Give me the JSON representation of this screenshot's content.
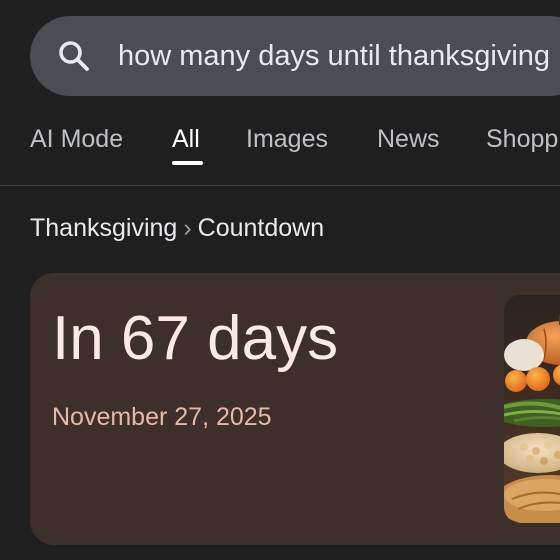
{
  "search": {
    "query": "how many days until thanksgiving",
    "icon": "search-icon"
  },
  "tabs": [
    {
      "label": "AI Mode",
      "active": false
    },
    {
      "label": "All",
      "active": true
    },
    {
      "label": "Images",
      "active": false
    },
    {
      "label": "News",
      "active": false
    },
    {
      "label": "Shopp",
      "active": false
    }
  ],
  "breadcrumb": {
    "root": "Thanksgiving",
    "separator": "›",
    "current": "Countdown"
  },
  "result": {
    "headline": "In 67 days",
    "date": "November 27, 2025",
    "image": "thanksgiving-food-image"
  },
  "colors": {
    "background": "#1f1f1f",
    "search_bar": "#4a4d52",
    "card": "#3d2f29",
    "headline": "#fbe9e2",
    "date": "#e5b9a7"
  }
}
